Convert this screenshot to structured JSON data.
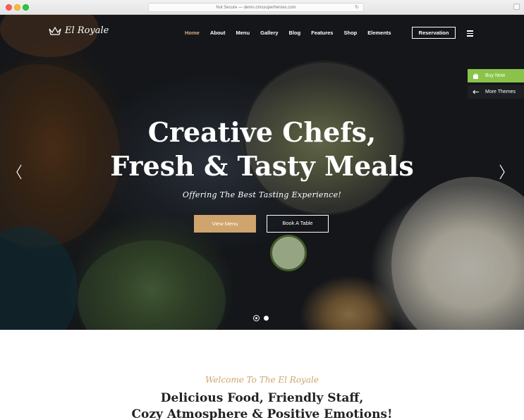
{
  "browser": {
    "url": "Not Secure — demo.cmssuperheroes.com"
  },
  "header": {
    "logo_text": "El Royale",
    "nav": [
      {
        "label": "Home"
      },
      {
        "label": "About"
      },
      {
        "label": "Menu"
      },
      {
        "label": "Gallery"
      },
      {
        "label": "Blog"
      },
      {
        "label": "Features"
      },
      {
        "label": "Shop"
      },
      {
        "label": "Elements"
      }
    ],
    "reservation_label": "Reservation",
    "active_nav": "Home"
  },
  "side_widgets": {
    "buy_now": "Buy Now",
    "more_themes": "More Themes"
  },
  "hero": {
    "title_line1": "Creative Chefs,",
    "title_line2": "Fresh & Tasty Meals",
    "subtitle": "Offering The Best Tasting Experience!",
    "btn_view_menu": "View Menu",
    "btn_book_table": "Book A Table",
    "slides_total": 2,
    "active_slide": 1
  },
  "welcome": {
    "script": "Welcome To The El Royale",
    "heading_line1": "Delicious Food, Friendly Staff,",
    "heading_line2": "Cozy Atmosphere & Positive Emotions!"
  },
  "colors": {
    "accent_gold": "#cfa46d",
    "buy_now_green": "#8bc34a",
    "more_themes_dark": "#1d1f22"
  },
  "icons": [
    "crown-icon",
    "menu-icon",
    "cart-icon",
    "arrow-left-icon",
    "chevron-left-icon",
    "chevron-right-icon",
    "reload-icon"
  ]
}
